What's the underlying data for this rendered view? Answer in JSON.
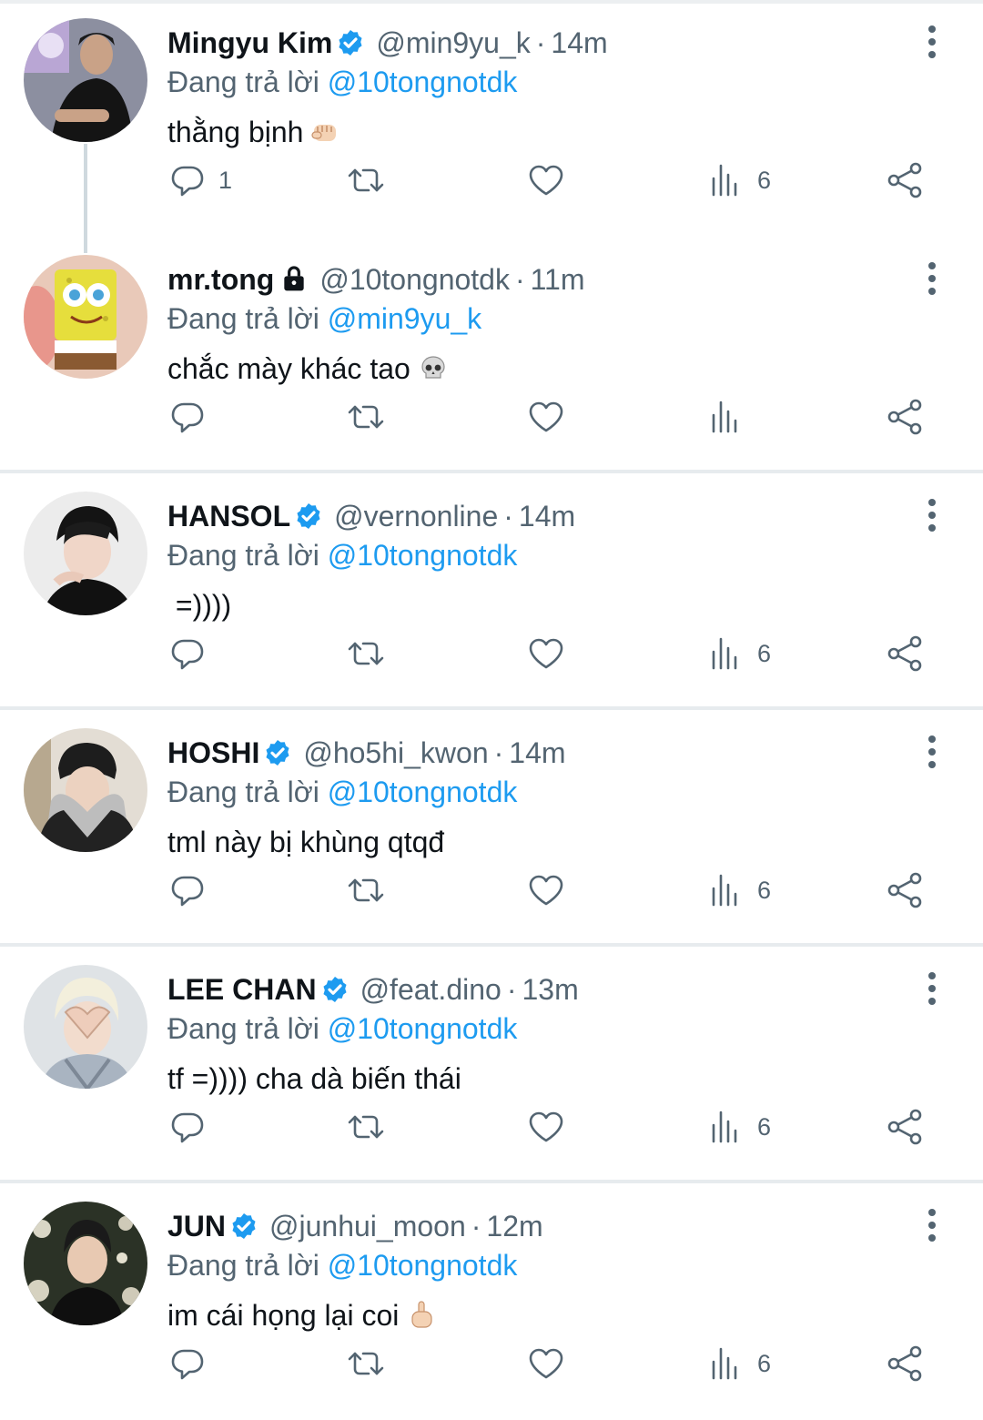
{
  "reply_prefix": "Đang trả lời",
  "accent_color": "#1d9bf0",
  "tweets": [
    {
      "name": "Mingyu Kim",
      "verified": true,
      "locked": false,
      "handle": "@min9yu_k",
      "time": "14m",
      "reply_to": "@10tongnotdk",
      "text": "thằng bịnh",
      "emoji": "fist-emoji",
      "replies": "1",
      "views": "6",
      "thread_continues": true
    },
    {
      "name": "mr.tong",
      "verified": false,
      "locked": true,
      "handle": "@10tongnotdk",
      "time": "11m",
      "reply_to": "@min9yu_k",
      "text": "chắc mày khác tao",
      "emoji": "skull-emoji",
      "replies": "",
      "views": "",
      "thread_continues": false
    },
    {
      "name": "HANSOL",
      "verified": true,
      "locked": false,
      "handle": "@vernonline",
      "time": "14m",
      "reply_to": "@10tongnotdk",
      "text": " =))))",
      "emoji": "",
      "replies": "",
      "views": "6",
      "thread_continues": false
    },
    {
      "name": "HOSHI",
      "verified": true,
      "locked": false,
      "handle": "@ho5hi_kwon",
      "time": "14m",
      "reply_to": "@10tongnotdk",
      "text": "tml này bị khùng qtqđ",
      "emoji": "",
      "replies": "",
      "views": "6",
      "thread_continues": false
    },
    {
      "name": "LEE CHAN",
      "verified": true,
      "locked": false,
      "handle": "@feat.dino",
      "time": "13m",
      "reply_to": "@10tongnotdk",
      "text": "tf =)))) cha dà biến thái",
      "emoji": "",
      "replies": "",
      "views": "6",
      "thread_continues": false
    },
    {
      "name": "JUN",
      "verified": true,
      "locked": false,
      "handle": "@junhui_moon",
      "time": "12m",
      "reply_to": "@10tongnotdk",
      "text": "im cái họng lại coi",
      "emoji": "middle-finger-emoji",
      "replies": "",
      "views": "6",
      "thread_continues": false
    }
  ]
}
